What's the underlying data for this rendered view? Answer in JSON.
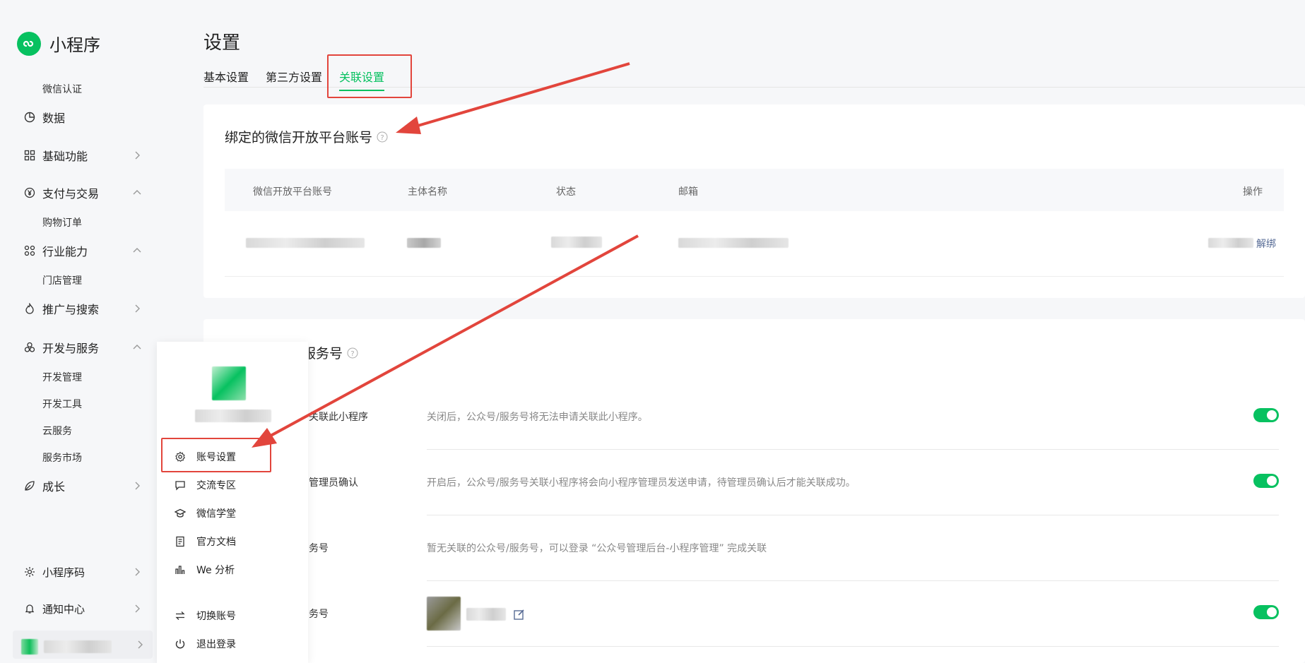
{
  "brand": {
    "title": "小程序"
  },
  "sidebar": {
    "sub_top": "微信认证",
    "items": [
      {
        "label": "数据"
      },
      {
        "label": "基础功能"
      },
      {
        "label": "支付与交易"
      },
      {
        "label": "行业能力"
      },
      {
        "label": "推广与搜索"
      },
      {
        "label": "开发与服务"
      },
      {
        "label": "成长"
      }
    ],
    "subs": {
      "payment": [
        "购物订单"
      ],
      "industry": [
        "门店管理"
      ],
      "dev": [
        "开发管理",
        "开发工具",
        "云服务",
        "服务市场"
      ]
    },
    "bottom": [
      {
        "label": "小程序码"
      },
      {
        "label": "通知中心"
      }
    ]
  },
  "header": {
    "title": "设置",
    "tabs": [
      "基本设置",
      "第三方设置",
      "关联设置"
    ]
  },
  "open_platform": {
    "title": "绑定的微信开放平台账号",
    "columns": [
      "微信开放平台账号",
      "主体名称",
      "状态",
      "邮箱",
      "操作"
    ],
    "row_action": "解绑"
  },
  "service": {
    "title": "服务号",
    "rows": [
      {
        "label": "关联此小程序",
        "desc": "关闭后，公众号/服务号将无法申请关联此小程序。"
      },
      {
        "label": "管理员确认",
        "desc": "开启后，公众号/服务号关联小程序将会向小程序管理员发送申请，待管理员确认后才能关联成功。"
      },
      {
        "label": "务号",
        "desc": "暂无关联的公众号/服务号，可以登录 “公众号管理后台-小程序管理” 完成关联"
      },
      {
        "label": "务号",
        "desc": ""
      }
    ]
  },
  "popup": {
    "items": [
      "账号设置",
      "交流专区",
      "微信学堂",
      "官方文档",
      "We 分析",
      "切换账号",
      "退出登录"
    ]
  },
  "colors": {
    "accent": "#07c160",
    "annotation": "#e2453c",
    "link": "#576b95"
  }
}
